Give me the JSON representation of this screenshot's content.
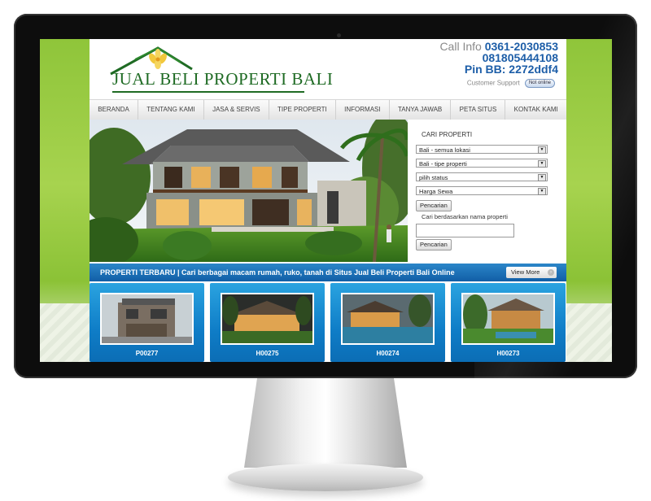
{
  "header": {
    "logo_text": "JUAL BELI PROPERTI BALI",
    "call_label": "Call Info",
    "phone1": "0361-2030853",
    "phone2": "081805444108",
    "pin_bb": "Pin BB: 2272ddf4",
    "support_label": "Customer Support",
    "support_status": "Not online"
  },
  "nav": {
    "items": [
      "BERANDA",
      "TENTANG KAMI",
      "JASA & SERVIS",
      "TIPE PROPERTI",
      "INFORMASI",
      "TANYA JAWAB",
      "PETA SITUS",
      "KONTAK KAMI"
    ]
  },
  "search": {
    "title": "CARI PROPERTI",
    "location_value": "Bali - semua lokasi",
    "type_value": "Bali - tipe properti",
    "status_value": "pilih status",
    "price_value": "Harga Sewa",
    "search_button": "Pencarian",
    "name_label": "Cari berdasarkan nama properti",
    "name_value": "",
    "name_button": "Pencarian"
  },
  "banner": {
    "text": "PROPERTI TERBARU | Cari berbagai macam rumah, ruko, tanah di Situs Jual Beli Properti Bali Online",
    "view_more": "View More"
  },
  "listings": [
    {
      "code": "P00277"
    },
    {
      "code": "H00275"
    },
    {
      "code": "H00274"
    },
    {
      "code": "H00273"
    }
  ],
  "colors": {
    "brand_green": "#1f6b24",
    "accent_blue": "#1d5ea8",
    "background_green": "#8fc53a",
    "banner_blue": "#115ea6"
  }
}
